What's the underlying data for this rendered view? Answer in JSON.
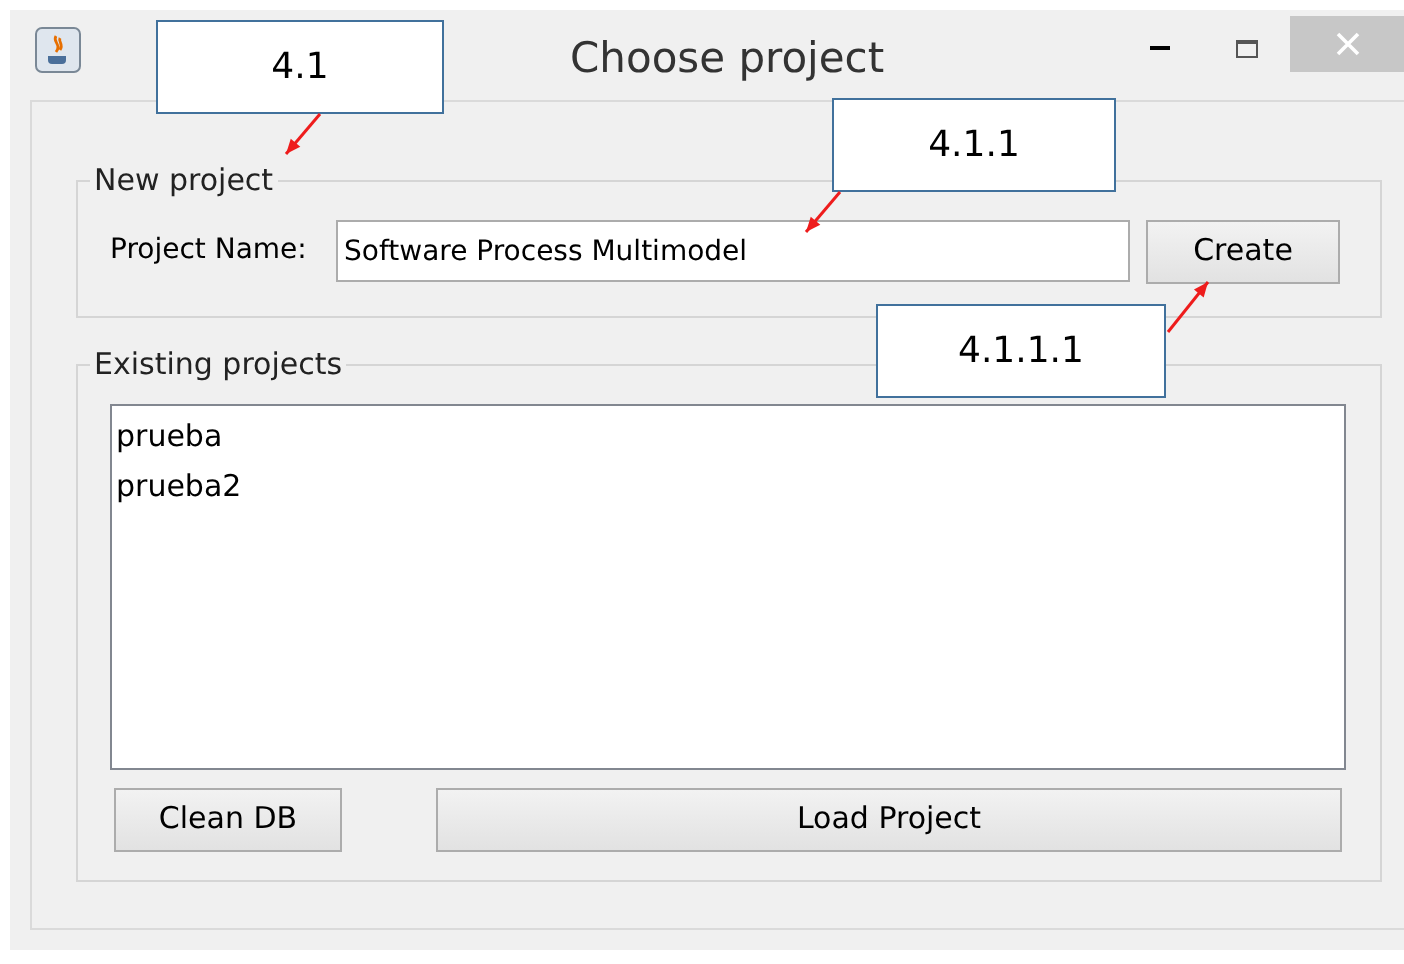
{
  "window": {
    "title": "Choose project"
  },
  "new_project": {
    "legend": "New project",
    "label": "Project Name:",
    "value": "Software Process Multimodel",
    "button": "Create"
  },
  "existing_projects": {
    "legend": "Existing projects",
    "items": [
      "prueba",
      "prueba2"
    ]
  },
  "buttons": [
    "Clean DB",
    "Load Project"
  ],
  "callouts": [
    "4.1",
    "4.1.1",
    "4.1.1.1"
  ]
}
